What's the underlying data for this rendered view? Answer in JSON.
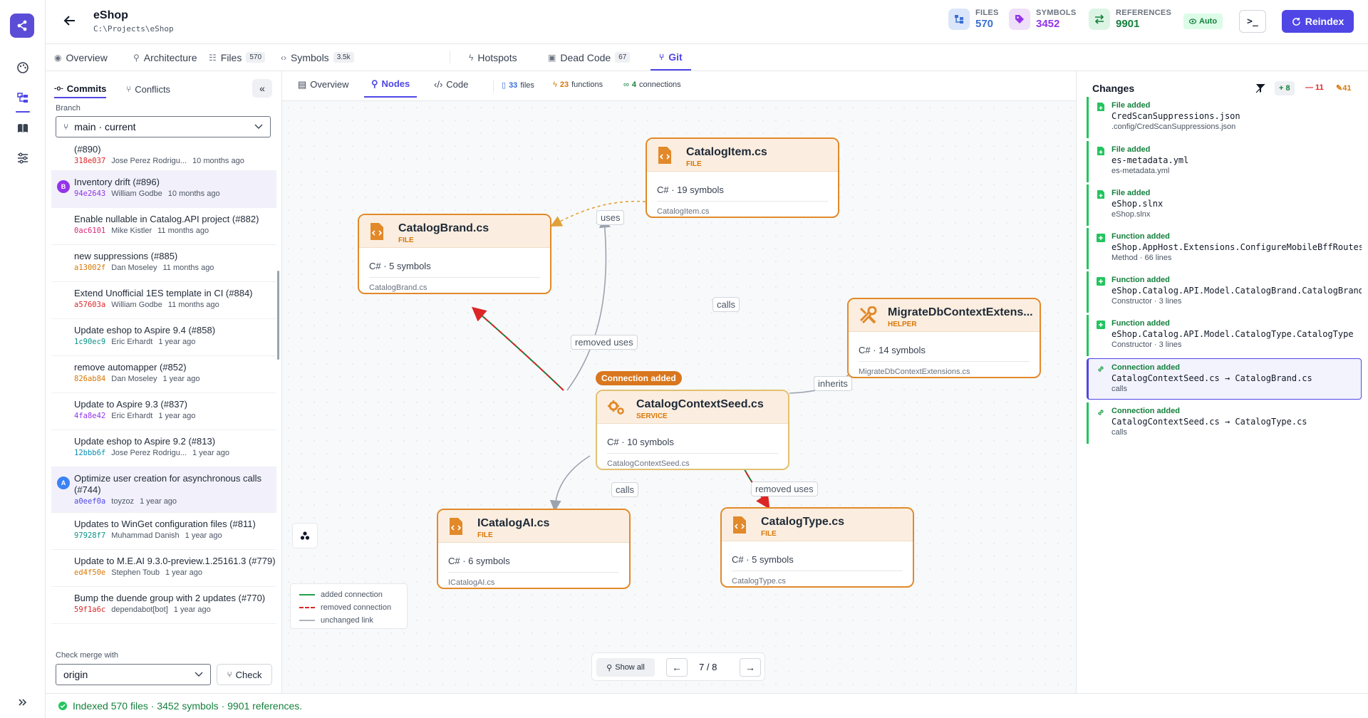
{
  "app": {
    "title": "eShop",
    "path": "C:\\Projects\\eShop"
  },
  "stats": [
    {
      "label": "FILES",
      "value": "570",
      "color": "#3b6fd4"
    },
    {
      "label": "SYMBOLS",
      "value": "3452",
      "color": "#9333ea"
    },
    {
      "label": "REFERENCES",
      "value": "9901",
      "color": "#15803d"
    }
  ],
  "header": {
    "auto_label": "Auto",
    "term_label": ">_",
    "reindex_label": "Reindex"
  },
  "tabs": [
    {
      "label": "Overview",
      "count": ""
    },
    {
      "label": "Architecture",
      "count": ""
    },
    {
      "label": "Files",
      "count": "570"
    },
    {
      "label": "Symbols",
      "count": "3.5k"
    },
    {
      "label": "Hotspots",
      "count": ""
    },
    {
      "label": "Dead Code",
      "count": "67"
    },
    {
      "label": "Git",
      "count": ""
    }
  ],
  "left": {
    "subtabs": [
      "Commits",
      "Conflicts"
    ],
    "branch_label": "Branch",
    "branch_value": "main · current",
    "commits": [
      {
        "title": "(#890)",
        "sha": "318e037",
        "author": "Jose Perez Rodrigu...",
        "time": "10 months ago",
        "sha_color": "#dc2626",
        "avatar": "",
        "avatar_color": "",
        "hl": false
      },
      {
        "title": "Inventory drift (#896)",
        "sha": "94e2643",
        "author": "William Godbe",
        "time": "10 months ago",
        "sha_color": "#9333ea",
        "avatar": "B",
        "avatar_color": "#9333ea",
        "hl": true
      },
      {
        "title": "Enable nullable in Catalog.API project (#882)",
        "sha": "0ac6101",
        "author": "Mike Kistler",
        "time": "11 months ago",
        "sha_color": "#db2777",
        "avatar": "",
        "avatar_color": "",
        "hl": false
      },
      {
        "title": "new suppressions (#885)",
        "sha": "a13002f",
        "author": "Dan Moseley",
        "time": "11 months ago",
        "sha_color": "#d97706",
        "avatar": "",
        "avatar_color": "",
        "hl": false
      },
      {
        "title": "Extend Unofficial 1ES template in CI (#884)",
        "sha": "a57603a",
        "author": "William Godbe",
        "time": "11 months ago",
        "sha_color": "#dc2626",
        "avatar": "",
        "avatar_color": "",
        "hl": false
      },
      {
        "title": "Update eshop to Aspire 9.4 (#858)",
        "sha": "1c90ec9",
        "author": "Eric Erhardt",
        "time": "1 year ago",
        "sha_color": "#0d9488",
        "avatar": "",
        "avatar_color": "",
        "hl": false
      },
      {
        "title": "remove automapper (#852)",
        "sha": "826ab84",
        "author": "Dan Moseley",
        "time": "1 year ago",
        "sha_color": "#d97706",
        "avatar": "",
        "avatar_color": "",
        "hl": false
      },
      {
        "title": "Update to Aspire 9.3 (#837)",
        "sha": "4fa8e42",
        "author": "Eric Erhardt",
        "time": "1 year ago",
        "sha_color": "#9333ea",
        "avatar": "",
        "avatar_color": "",
        "hl": false
      },
      {
        "title": "Update eshop to Aspire 9.2 (#813)",
        "sha": "12bbb6f",
        "author": "Jose Perez Rodrigu...",
        "time": "1 year ago",
        "sha_color": "#0891b2",
        "avatar": "",
        "avatar_color": "",
        "hl": false
      },
      {
        "title": "Optimize user creation for asynchronous calls (#744)",
        "sha": "a0eef0a",
        "author": "toyzoz",
        "time": "1 year ago",
        "sha_color": "#4f46e5",
        "avatar": "A",
        "avatar_color": "#3b82f6",
        "hl": true
      },
      {
        "title": "Updates to WinGet configuration files (#811)",
        "sha": "97928f7",
        "author": "Muhammad Danish",
        "time": "1 year ago",
        "sha_color": "#0d9488",
        "avatar": "",
        "avatar_color": "",
        "hl": false
      },
      {
        "title": "Update to M.E.AI 9.3.0-preview.1.25161.3 (#779)",
        "sha": "ed4f50e",
        "author": "Stephen Toub",
        "time": "1 year ago",
        "sha_color": "#d97706",
        "avatar": "",
        "avatar_color": "",
        "hl": false
      },
      {
        "title": "Bump the duende group with 2 updates (#770)",
        "sha": "59f1a6c",
        "author": "dependabot[bot]",
        "time": "1 year ago",
        "sha_color": "#dc2626",
        "avatar": "",
        "avatar_color": "",
        "hl": false
      }
    ],
    "merge_label": "Check merge with",
    "merge_value": "origin",
    "check_label": "Check"
  },
  "center": {
    "views": [
      "Overview",
      "Nodes",
      "Code"
    ],
    "stats": {
      "files": "33",
      "files_label": "files",
      "functions": "23",
      "functions_label": "functions",
      "connections": "4",
      "connections_label": "connections"
    },
    "nodes": [
      {
        "name": "CatalogItem.cs",
        "type": "FILE",
        "symbols": "C# · 19 symbols",
        "file": "CatalogItem.cs"
      },
      {
        "name": "CatalogBrand.cs",
        "type": "FILE",
        "symbols": "C# · 5 symbols",
        "file": "CatalogBrand.cs"
      },
      {
        "name": "MigrateDbContextExtens...",
        "type": "HELPER",
        "symbols": "C# · 14 symbols",
        "file": "MigrateDbContextExtensions.cs"
      },
      {
        "name": "CatalogContextSeed.cs",
        "type": "SERVICE",
        "symbols": "C# · 10 symbols",
        "file": "CatalogContextSeed.cs"
      },
      {
        "name": "ICatalogAI.cs",
        "type": "FILE",
        "symbols": "C# · 6 symbols",
        "file": "ICatalogAI.cs"
      },
      {
        "name": "CatalogType.cs",
        "type": "FILE",
        "symbols": "C# · 5 symbols",
        "file": "CatalogType.cs"
      }
    ],
    "edges": {
      "uses": "uses",
      "calls_top": "calls",
      "removed_uses_1": "removed uses",
      "inherits": "inherits",
      "calls_bottom": "calls",
      "removed_uses_2": "removed uses"
    },
    "connection_badge": "Connection added",
    "legend": {
      "added": "added connection",
      "removed": "removed connection",
      "unchanged": "unchanged link"
    },
    "pager": {
      "show_all": "Show all",
      "current": "7",
      "sep": "/",
      "total": "8"
    }
  },
  "right": {
    "title": "Changes",
    "added": "+ 8",
    "removed": "— 11",
    "modified": "41",
    "items": [
      {
        "kind": "File added",
        "name": "CredScanSuppressions.json",
        "sub": ".config/CredScanSuppressions.json",
        "icon": "file"
      },
      {
        "kind": "File added",
        "name": "es-metadata.yml",
        "sub": "es-metadata.yml",
        "icon": "file"
      },
      {
        "kind": "File added",
        "name": "eShop.slnx",
        "sub": "eShop.slnx",
        "icon": "file"
      },
      {
        "kind": "Function added",
        "name": "eShop.AppHost.Extensions.ConfigureMobileBffRoutes",
        "sub": "Method · 66 lines",
        "icon": "plus"
      },
      {
        "kind": "Function added",
        "name": "eShop.Catalog.API.Model.CatalogBrand.CatalogBrand",
        "sub": "Constructor · 3 lines",
        "icon": "plus"
      },
      {
        "kind": "Function added",
        "name": "eShop.Catalog.API.Model.CatalogType.CatalogType",
        "sub": "Constructor · 3 lines",
        "icon": "plus"
      },
      {
        "kind": "Connection added",
        "name": "CatalogContextSeed.cs → CatalogBrand.cs",
        "sub": "calls",
        "icon": "link"
      },
      {
        "kind": "Connection added",
        "name": "CatalogContextSeed.cs → CatalogType.cs",
        "sub": "calls",
        "icon": "link"
      }
    ]
  },
  "status": {
    "text": "Indexed 570 files · 3452 symbols · 9901 references."
  }
}
